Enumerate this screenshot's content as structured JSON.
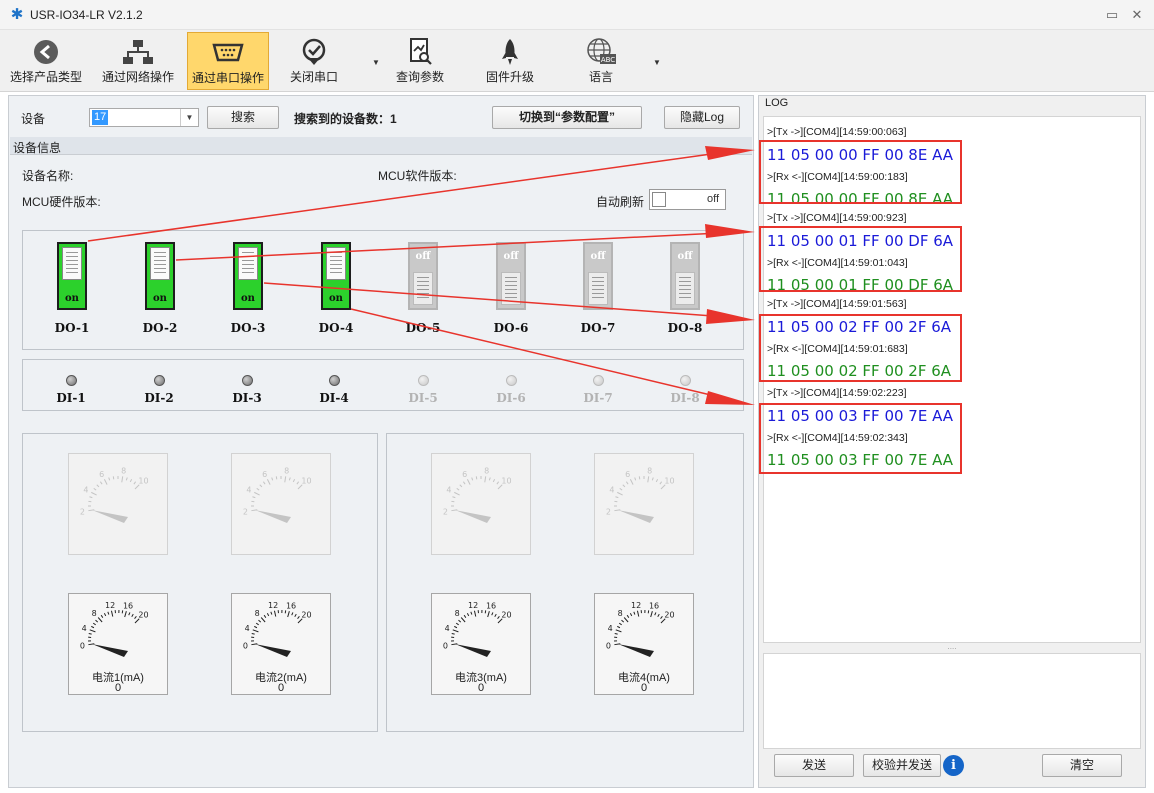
{
  "window": {
    "title": "USR-IO34-LR V2.1.2",
    "minimize_glyph": "▭",
    "close_glyph": "✕"
  },
  "toolbar": {
    "items": [
      {
        "label": "选择产品类型",
        "icon": "back-arrow-icon"
      },
      {
        "label": "通过网络操作",
        "icon": "network-icon"
      },
      {
        "label": "通过串口操作",
        "icon": "serial-port-icon",
        "active": true
      },
      {
        "label": "关闭串口",
        "icon": "check-circle-icon"
      },
      {
        "label": "查询参数",
        "icon": "query-doc-icon"
      },
      {
        "label": "固件升级",
        "icon": "rocket-icon"
      },
      {
        "label": "语言",
        "icon": "globe-abc-icon"
      }
    ],
    "abc_text": "ABC"
  },
  "device_bar": {
    "device_label": "设备",
    "device_value": "17",
    "search_label": "搜索",
    "found_label": "搜索到的设备数：1",
    "switch_label": "切换到“参数配置”",
    "hide_log_label": "隐藏Log"
  },
  "device_info": {
    "section_title": "设备信息",
    "name_label": "设备名称:",
    "mcu_sw_label": "MCU软件版本:",
    "mcu_hw_label": "MCU硬件版本:",
    "auto_refresh_label": "自动刷新",
    "auto_refresh_state": "off"
  },
  "do_outputs": [
    {
      "name": "DO-1",
      "state": "on"
    },
    {
      "name": "DO-2",
      "state": "on"
    },
    {
      "name": "DO-3",
      "state": "on"
    },
    {
      "name": "DO-4",
      "state": "on"
    },
    {
      "name": "DO-5",
      "state": "off"
    },
    {
      "name": "DO-6",
      "state": "off"
    },
    {
      "name": "DO-7",
      "state": "off"
    },
    {
      "name": "DO-8",
      "state": "off"
    }
  ],
  "di_inputs": [
    {
      "name": "DI-1",
      "active": true
    },
    {
      "name": "DI-2",
      "active": true
    },
    {
      "name": "DI-3",
      "active": true
    },
    {
      "name": "DI-4",
      "active": true
    },
    {
      "name": "DI-5",
      "active": false
    },
    {
      "name": "DI-6",
      "active": false
    },
    {
      "name": "DI-7",
      "active": false
    },
    {
      "name": "DI-8",
      "active": false
    }
  ],
  "gauges_top": {
    "ticks": [
      "2",
      "4",
      "6",
      "8",
      "10"
    ]
  },
  "gauges_bottom": {
    "ticks": [
      "0",
      "4",
      "8",
      "12",
      "16",
      "20"
    ],
    "items": [
      {
        "label": "电流1(mA)",
        "value": "0"
      },
      {
        "label": "电流2(mA)",
        "value": "0"
      },
      {
        "label": "电流3(mA)",
        "value": "0"
      },
      {
        "label": "电流4(mA)",
        "value": "0"
      }
    ]
  },
  "log": {
    "title": "LOG",
    "lines": [
      {
        "kind": "tx",
        "text": ">[Tx ->][COM4][14:59:00:063]"
      },
      {
        "kind": "data-tx",
        "text": "11 05 00 00 FF 00 8E AA"
      },
      {
        "kind": "rx",
        "text": ">[Rx <-][COM4][14:59:00:183]"
      },
      {
        "kind": "data-rx",
        "text": "11 05 00 00 FF 00 8E AA"
      },
      {
        "kind": "tx",
        "text": ">[Tx ->][COM4][14:59:00:923]"
      },
      {
        "kind": "data-tx",
        "text": "11 05 00 01 FF 00 DF 6A"
      },
      {
        "kind": "rx",
        "text": ">[Rx <-][COM4][14:59:01:043]"
      },
      {
        "kind": "data-rx",
        "text": "11 05 00 01 FF 00 DF 6A"
      },
      {
        "kind": "tx",
        "text": ">[Tx ->][COM4][14:59:01:563]"
      },
      {
        "kind": "data-tx",
        "text": "11 05 00 02 FF 00 2F 6A"
      },
      {
        "kind": "rx",
        "text": ">[Rx <-][COM4][14:59:01:683]"
      },
      {
        "kind": "data-rx",
        "text": "11 05 00 02 FF 00 2F 6A"
      },
      {
        "kind": "tx",
        "text": ">[Tx ->][COM4][14:59:02:223]"
      },
      {
        "kind": "data-tx",
        "text": "11 05 00 03 FF 00 7E AA"
      },
      {
        "kind": "rx",
        "text": ">[Rx <-][COM4][14:59:02:343]"
      },
      {
        "kind": "data-rx",
        "text": "11 05 00 03 FF 00 7E AA"
      }
    ],
    "splitter_grip": "....",
    "send_label": "发送",
    "check_send_label": "校验并发送",
    "info_glyph": "i",
    "clear_label": "清空"
  },
  "colors": {
    "on_green": "#2cd12c",
    "tx_blue": "#1a1ad8",
    "rx_green": "#1f8f1f",
    "annotation_red": "#e8342c",
    "active_tool": "#ffd76c"
  }
}
